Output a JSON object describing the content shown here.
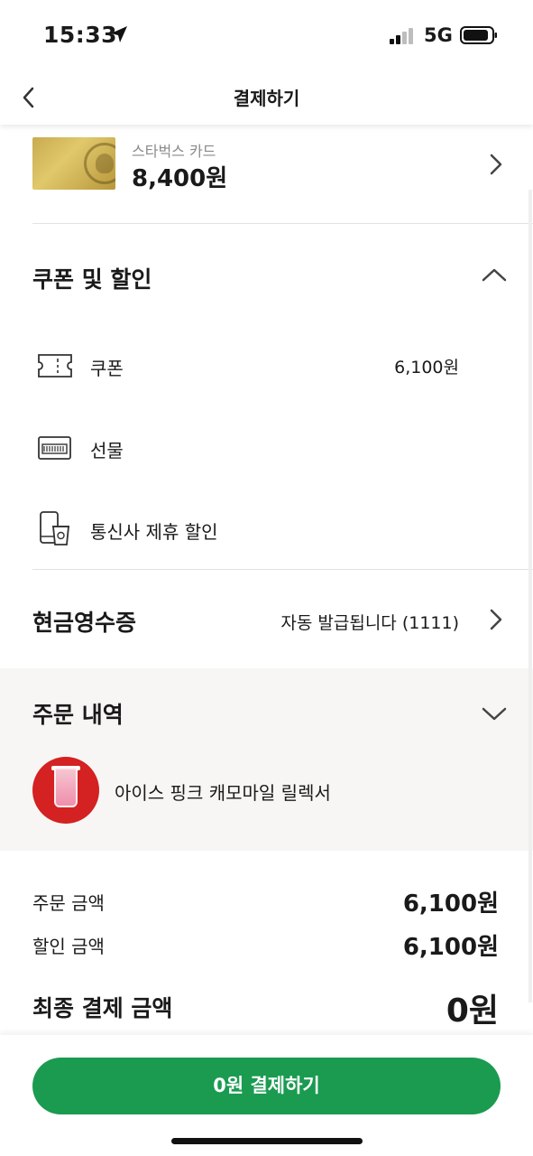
{
  "status_bar": {
    "time": "15:33",
    "network": "5G",
    "icons": [
      "location-arrow-icon",
      "signal-icon",
      "battery-icon"
    ]
  },
  "header": {
    "title": "결제하기",
    "back_icon": "chevron-left-icon"
  },
  "payment_card": {
    "name": "스타벅스 카드",
    "balance": "8,400원"
  },
  "coupons": {
    "title": "쿠폰 및 할인",
    "expanded": true,
    "items": [
      {
        "label": "쿠폰",
        "value": "6,100원",
        "icon": "ticket-icon"
      },
      {
        "label": "선물",
        "value": "",
        "icon": "gift-card-icon"
      },
      {
        "label": "통신사 제휴 할인",
        "value": "",
        "icon": "phone-cup-icon"
      }
    ]
  },
  "cash_receipt": {
    "title": "현금영수증",
    "value": "자동 발급됩니다 (1111)"
  },
  "order": {
    "title": "주문 내역",
    "expanded": false,
    "items": [
      {
        "name": "아이스 핑크 캐모마일 릴렉서"
      }
    ]
  },
  "summary": {
    "order_amount_label": "주문 금액",
    "order_amount": "6,100원",
    "discount_label": "할인 금액",
    "discount_amount": "6,100원",
    "final_label": "최종 결제 금액",
    "final_amount": "0원"
  },
  "pay_button": {
    "label": "0원 결제하기"
  },
  "colors": {
    "accent": "#1a9b50",
    "order_bg": "#f7f6f4",
    "thumb_bg": "#d42121"
  }
}
